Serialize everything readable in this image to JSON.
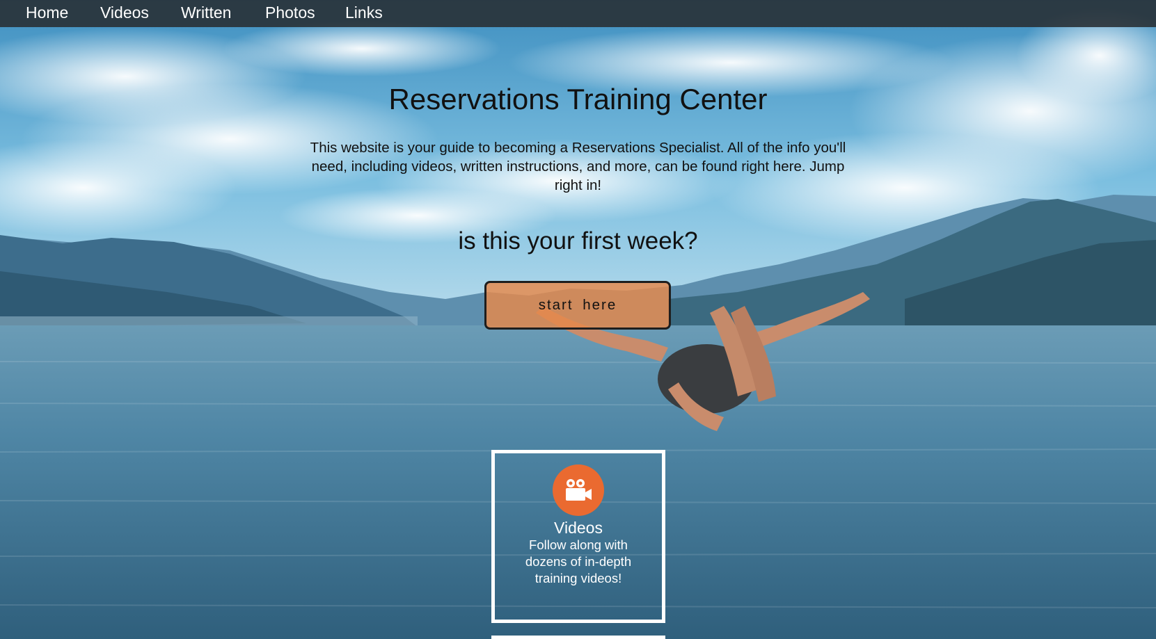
{
  "nav": {
    "home": "Home",
    "videos": "Videos",
    "written": "Written",
    "photos": "Photos",
    "links": "Links"
  },
  "hero": {
    "title": "Reservations Training Center",
    "intro": "This website is your guide to becoming a Reservations Specialist. All of the info you'll need, including videos, written instructions, and more, can be found right here. Jump right in!",
    "subhead": "is this your first week?",
    "button_label": "start here"
  },
  "cards": [
    {
      "title": "Videos",
      "description": "Follow along with dozens of in-depth training videos!",
      "icon": "video-camera-icon",
      "icon_color": "#ea6a30"
    }
  ],
  "colors": {
    "button_fill": "#e7894a",
    "nav_bg": "#282e32",
    "card_border": "#ffffff"
  }
}
